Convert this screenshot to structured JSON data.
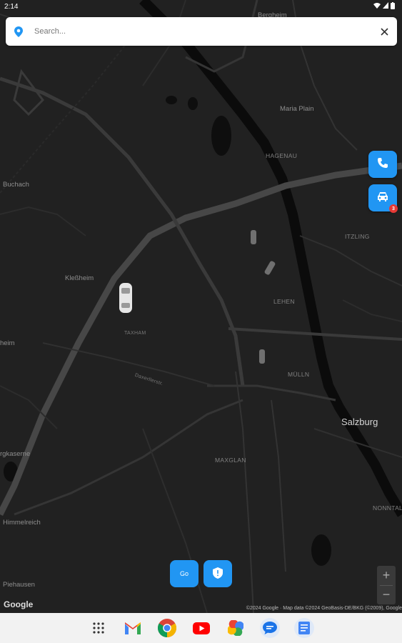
{
  "status_bar": {
    "time": "2:14"
  },
  "search": {
    "placeholder": "Search..."
  },
  "map": {
    "places": {
      "bergheim": "Bergheim",
      "maria_plain": "Maria Plain",
      "hagenau": "HAGENAU",
      "buchach": "Buchach",
      "itzling": "ITZLING",
      "klessheim": "Kleßheim",
      "lehen": "LEHEN",
      "taxham": "TAXHAM",
      "heim": "heim",
      "mulln": "MÜLLN",
      "salzburg": "Salzburg",
      "kaserne": "rgkaserne",
      "maxglan": "MAXGLAN",
      "nonntal": "NONNTAL",
      "himmelreich": "Himmelreich",
      "piehausen": "Piehausen",
      "street1": "Daxerllerstr."
    },
    "google_logo": "Google",
    "attribution": "©2024 Google · Map data ©2024 GeoBasis-DE/BKG (©2009), Google"
  },
  "buttons": {
    "call_icon": "phone-icon",
    "taxi_icon": "taxi-icon",
    "taxi_badge": "3",
    "go_label": "Go",
    "shield_icon": "shield-icon",
    "zoom_in": "+",
    "zoom_out": "−"
  },
  "taskbar": {
    "apps": [
      "app-drawer",
      "gmail",
      "chrome",
      "youtube",
      "photos",
      "messages",
      "files"
    ]
  },
  "colors": {
    "accent": "#2196f3",
    "badge": "#e53935",
    "map_bg": "#212121",
    "road": "#3d3d3d"
  }
}
